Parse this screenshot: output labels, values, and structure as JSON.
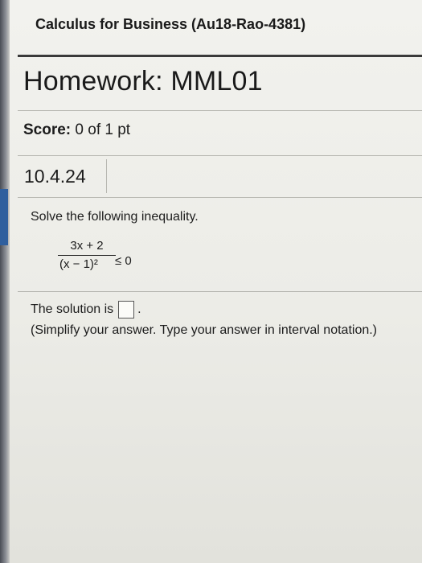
{
  "course": {
    "title": "Calculus for Business (Au18-Rao-4381)"
  },
  "homework": {
    "title": "Homework: MML01"
  },
  "score": {
    "label": "Score:",
    "value": "0 of 1 pt"
  },
  "question": {
    "number": "10.4.24",
    "instruction": "Solve the following inequality.",
    "numerator": "3x + 2",
    "denominator": "(x − 1)²",
    "relation": "≤ 0",
    "solution_prefix": "The solution is",
    "solution_suffix": ".",
    "hint": "(Simplify your answer. Type your answer in interval notation.)"
  },
  "colors": {
    "side_tab": "#2f5f9e",
    "background": "#efefea"
  }
}
